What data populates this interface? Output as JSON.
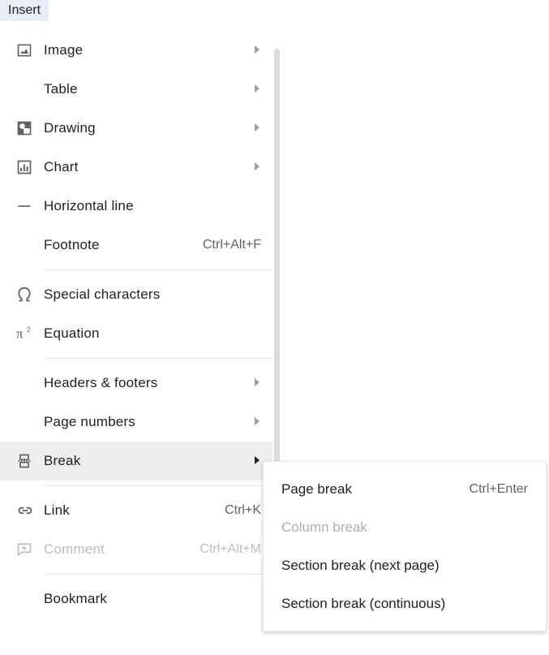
{
  "menuTab": "Insert",
  "menu": {
    "image": {
      "label": "Image"
    },
    "table": {
      "label": "Table"
    },
    "drawing": {
      "label": "Drawing"
    },
    "chart": {
      "label": "Chart"
    },
    "horizontalLine": {
      "label": "Horizontal line"
    },
    "footnote": {
      "label": "Footnote",
      "shortcut": "Ctrl+Alt+F"
    },
    "specialCharacters": {
      "label": "Special characters"
    },
    "equation": {
      "label": "Equation"
    },
    "headersFooters": {
      "label": "Headers & footers"
    },
    "pageNumbers": {
      "label": "Page numbers"
    },
    "break": {
      "label": "Break"
    },
    "link": {
      "label": "Link",
      "shortcut": "Ctrl+K"
    },
    "comment": {
      "label": "Comment",
      "shortcut": "Ctrl+Alt+M"
    },
    "bookmark": {
      "label": "Bookmark"
    }
  },
  "submenu": {
    "pageBreak": {
      "label": "Page break",
      "shortcut": "Ctrl+Enter"
    },
    "columnBreak": {
      "label": "Column break"
    },
    "sectionNextPage": {
      "label": "Section break (next page)"
    },
    "sectionContinuous": {
      "label": "Section break (continuous)"
    }
  }
}
